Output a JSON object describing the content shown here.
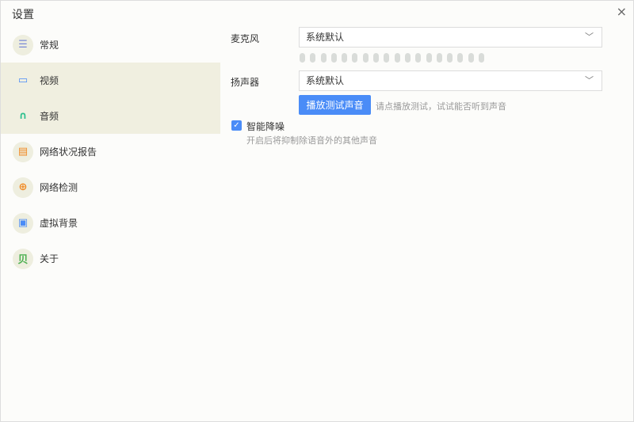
{
  "title": "设置",
  "close_icon": "×",
  "sidebar": {
    "items": [
      {
        "label": "常规",
        "icon": "sliders-icon",
        "glyph": "☰",
        "color": "#7b8ad6"
      },
      {
        "label": "视频",
        "icon": "video-icon",
        "glyph": "▭",
        "color": "#4a8cf7"
      },
      {
        "label": "音频",
        "icon": "headphones-icon",
        "glyph": "∩",
        "color": "#2fc08f"
      },
      {
        "label": "网络状况报告",
        "icon": "report-icon",
        "glyph": "▤",
        "color": "#f08a24"
      },
      {
        "label": "网络检测",
        "icon": "globe-icon",
        "glyph": "⊕",
        "color": "#f08a24"
      },
      {
        "label": "虚拟背景",
        "icon": "portrait-icon",
        "glyph": "▣",
        "color": "#4a8cf7"
      },
      {
        "label": "关于",
        "icon": "about-icon",
        "glyph": "贝",
        "color": "#4caf50"
      }
    ],
    "selected": [
      "视频",
      "音频"
    ]
  },
  "main": {
    "microphone_label": "麦克风",
    "microphone_value": "系统默认",
    "mic_level": 0,
    "speaker_label": "扬声器",
    "speaker_value": "系统默认",
    "play_button": "播放测试声音",
    "play_hint": "请点播放测试，试试能否听到声音",
    "noise_label": "智能降噪",
    "noise_checked": true,
    "noise_desc": "开启后将抑制除语音外的其他声音"
  }
}
